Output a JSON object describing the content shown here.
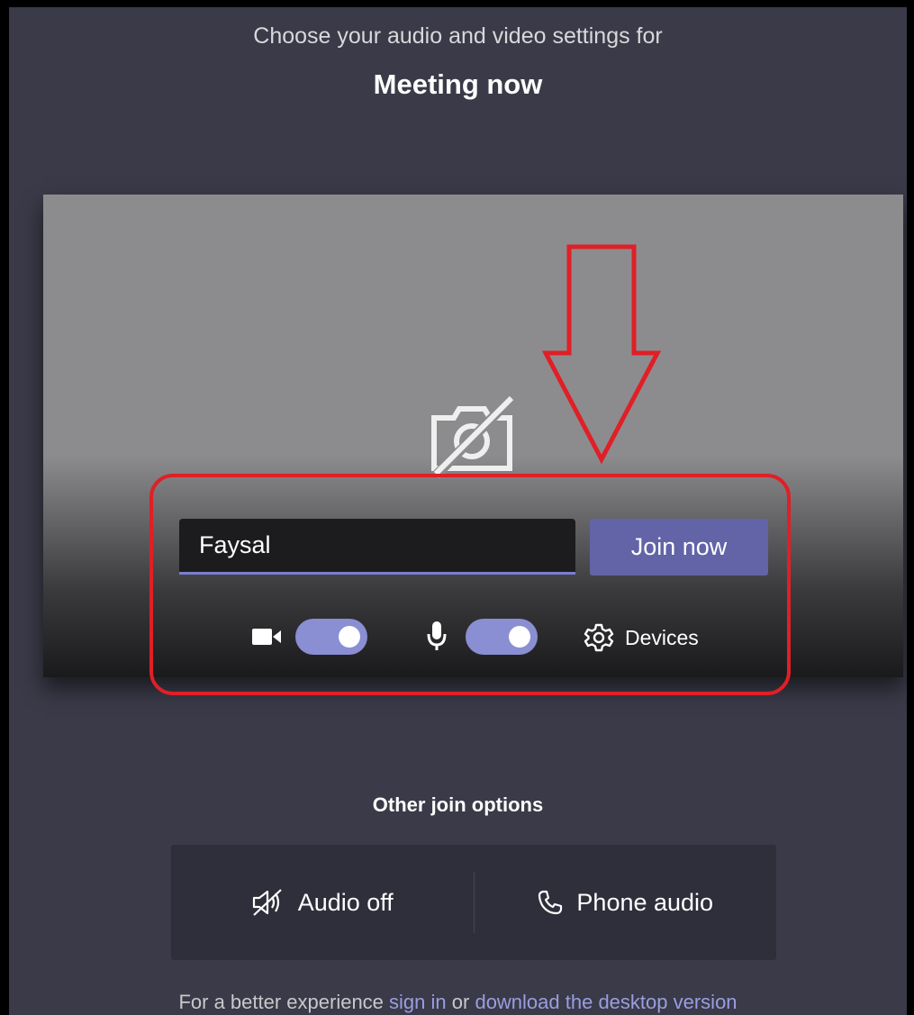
{
  "header": {
    "subtitle": "Choose your audio and video settings for",
    "meeting_title": "Meeting now"
  },
  "preview": {
    "camera_icon": "camera-off-icon",
    "name_value": "Faysal",
    "join_label": "Join now",
    "camera_toggle_on": true,
    "mic_toggle_on": true,
    "devices_label": "Devices"
  },
  "annotation": {
    "color": "#e01f26"
  },
  "other_options": {
    "title": "Other join options",
    "audio_off_label": "Audio off",
    "phone_audio_label": "Phone audio"
  },
  "footer": {
    "prefix": "For a better experience",
    "sign_in": "sign in",
    "middle": "or",
    "download": "download the desktop version"
  },
  "colors": {
    "background": "#3a3a48",
    "accent": "#6264a7",
    "toggle": "#8a8ed2",
    "link": "#9a9ee0"
  }
}
